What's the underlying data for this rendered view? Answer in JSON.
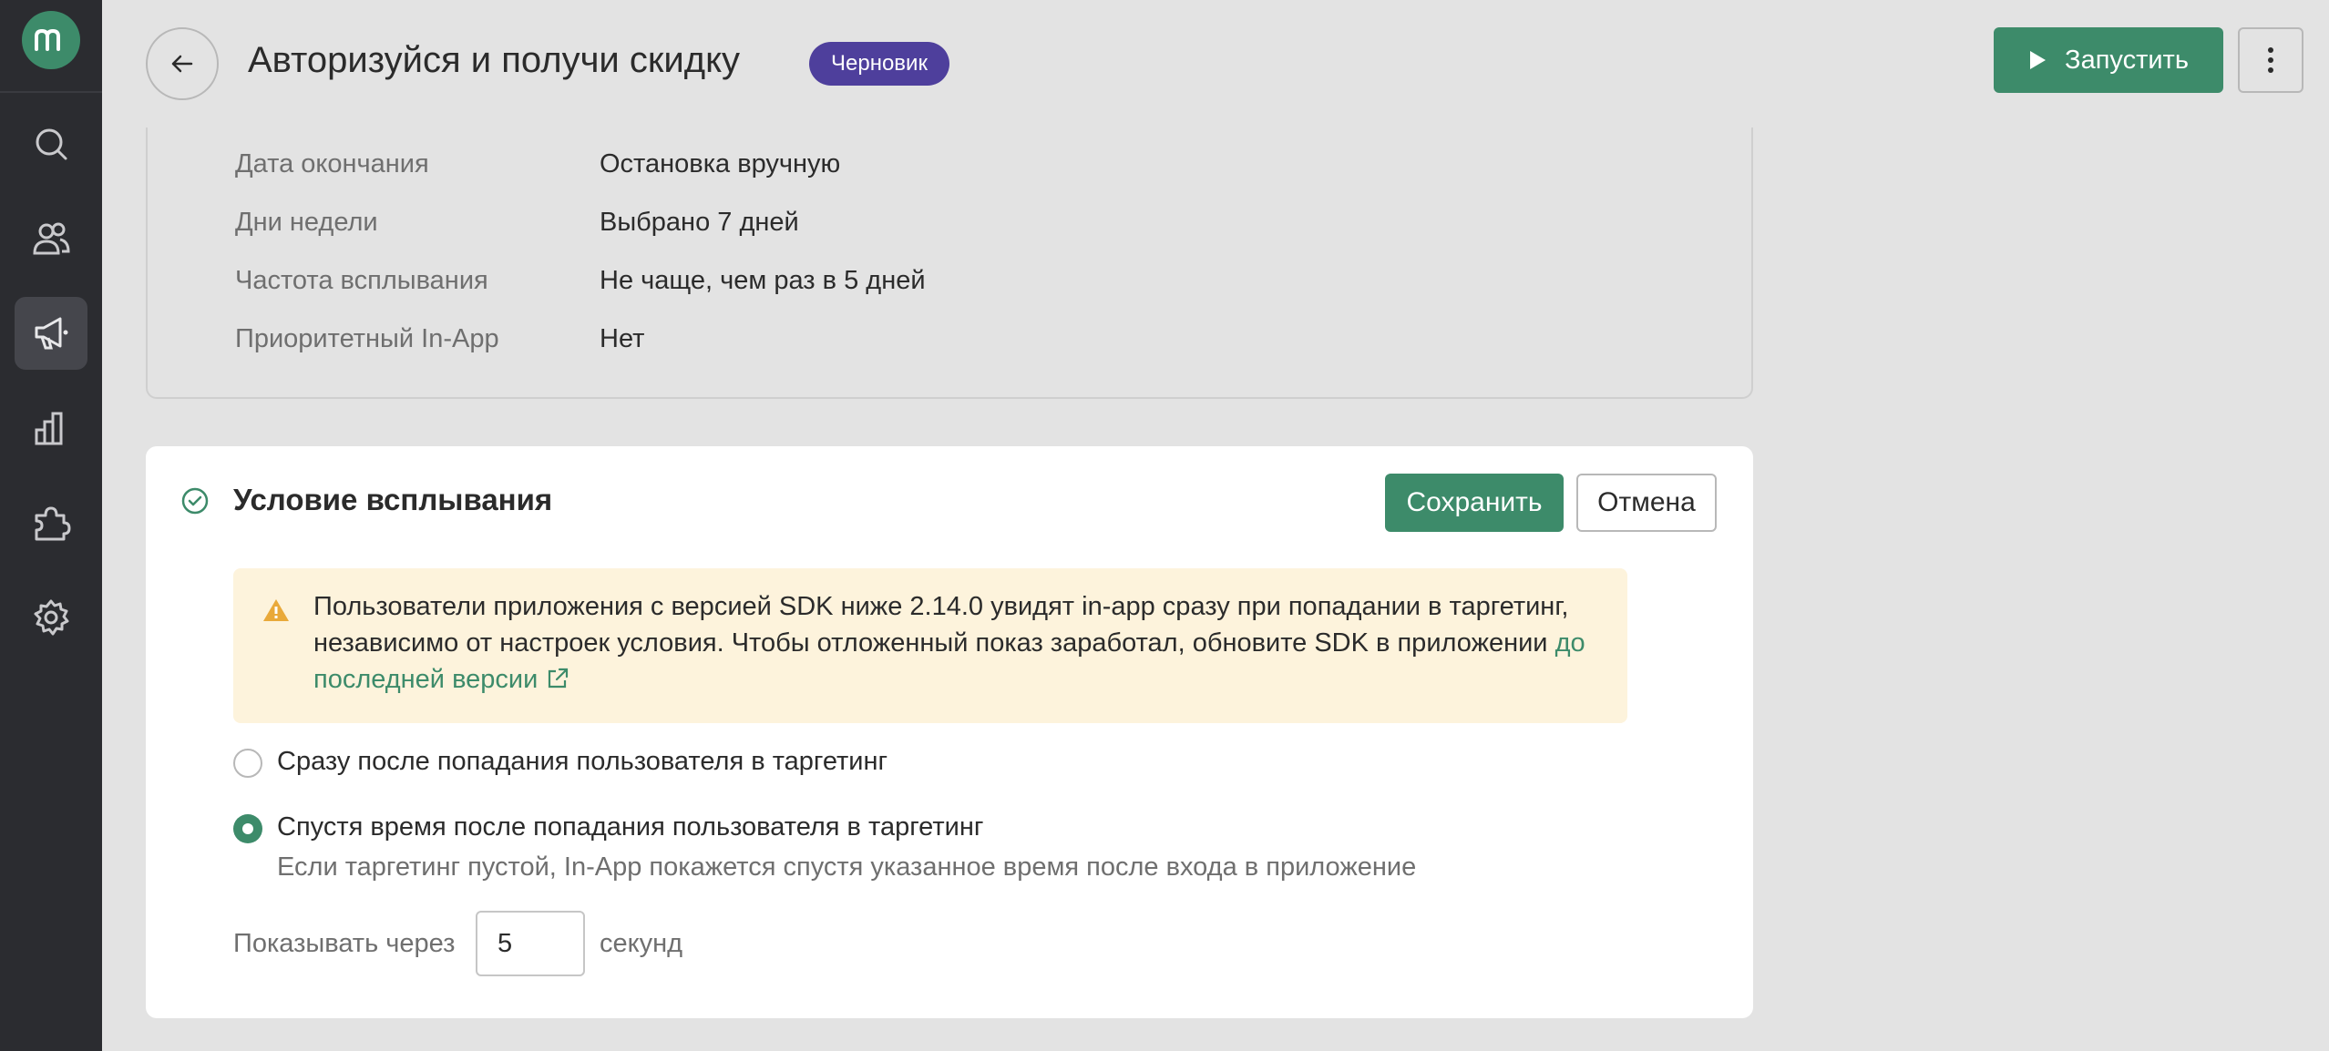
{
  "header": {
    "title": "Авторизуйся и получи скидку",
    "status": "Черновик",
    "launch_label": "Запустить"
  },
  "sidebar": {
    "items": [
      {
        "icon": "search-icon"
      },
      {
        "icon": "users-icon"
      },
      {
        "icon": "megaphone-icon",
        "active": true
      },
      {
        "icon": "chart-icon"
      },
      {
        "icon": "puzzle-icon"
      },
      {
        "icon": "gear-icon"
      }
    ]
  },
  "settings": {
    "rows": [
      {
        "key": "Дата окончания",
        "value": "Остановка вручную"
      },
      {
        "key": "Дни недели",
        "value": "Выбрано 7 дней"
      },
      {
        "key": "Частота всплывания",
        "value": "Не чаще, чем раз в 5 дней"
      },
      {
        "key": "Приоритетный In-App",
        "value": "Нет"
      }
    ]
  },
  "condition": {
    "title": "Условие всплывания",
    "save_label": "Сохранить",
    "cancel_label": "Отмена",
    "warning_text": "Пользователи приложения с версией SDK ниже 2.14.0 увидят in-app сразу при попадании в таргетинг, независимо от настроек условия. Чтобы отложенный показ заработал, обновите SDK в приложении ",
    "warning_link": "до последней версии",
    "option_immediate": "Сразу после попадания пользователя в таргетинг",
    "option_delayed": "Спустя время после попадания пользователя в таргетинг",
    "option_delayed_hint": "Если таргетинг пустой, In-App покажется спустя указанное время после входа в приложение",
    "selected_option": "delayed",
    "delay_label": "Показывать через",
    "delay_value": "5",
    "delay_unit": "секунд"
  },
  "colors": {
    "accent": "#3d8b6a",
    "badge": "#4e3f9c",
    "warning_bg": "#fdf3dc",
    "warning_icon": "#e9a93a"
  }
}
